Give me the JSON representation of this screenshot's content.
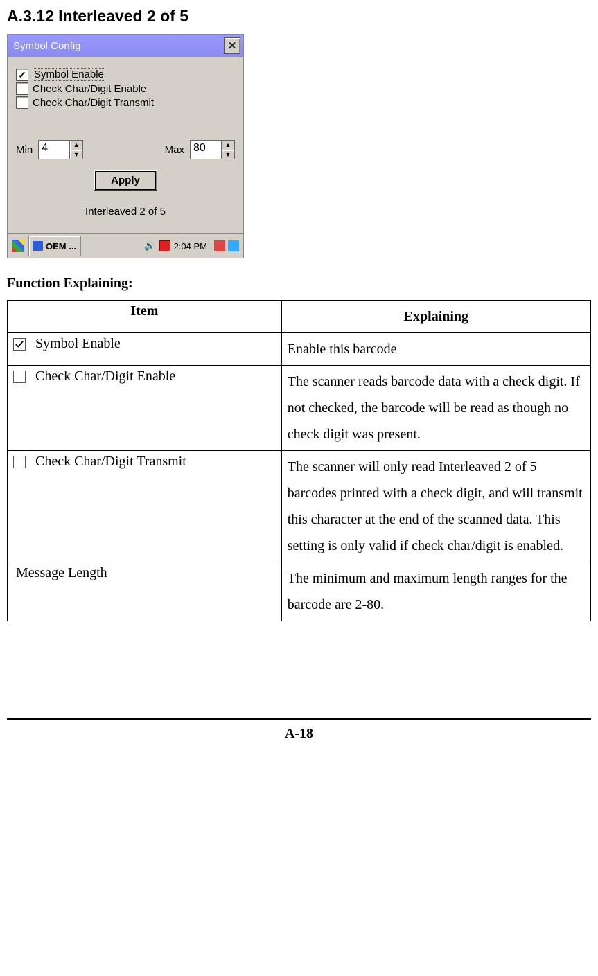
{
  "heading": "A.3.12 Interleaved 2 of 5",
  "dialog": {
    "title": "Symbol Config",
    "checkboxes": [
      {
        "label": "Symbol Enable",
        "checked": true,
        "selected": true
      },
      {
        "label": "Check Char/Digit Enable",
        "checked": false,
        "selected": false
      },
      {
        "label": "Check Char/Digit Transmit",
        "checked": false,
        "selected": false
      }
    ],
    "min_label": "Min",
    "min_value": "4",
    "max_label": "Max",
    "max_value": "80",
    "apply_label": "Apply",
    "caption": "Interleaved 2 of 5"
  },
  "taskbar": {
    "app_label": "OEM ...",
    "time": "2:04 PM"
  },
  "function_heading": "Function Explaining:",
  "table": {
    "headers": {
      "item": "Item",
      "explain": "Explaining"
    },
    "rows": [
      {
        "checkbox": "checked",
        "item": "Symbol Enable",
        "explain": "Enable this barcode"
      },
      {
        "checkbox": "unchecked",
        "item": "Check Char/Digit Enable",
        "explain": "The scanner reads barcode data with a check digit. If not checked, the barcode will be read as though no check digit was present."
      },
      {
        "checkbox": "unchecked",
        "item": "Check Char/Digit Transmit",
        "explain": "The scanner will only read Interleaved 2 of 5 barcodes printed with a check digit, and will transmit this character at the end of the scanned data. This setting is only valid if check char/digit is enabled."
      },
      {
        "checkbox": "none",
        "item": "Message Length",
        "explain": "The minimum and maximum length ranges for the barcode are 2-80."
      }
    ]
  },
  "page_number": "A-18"
}
